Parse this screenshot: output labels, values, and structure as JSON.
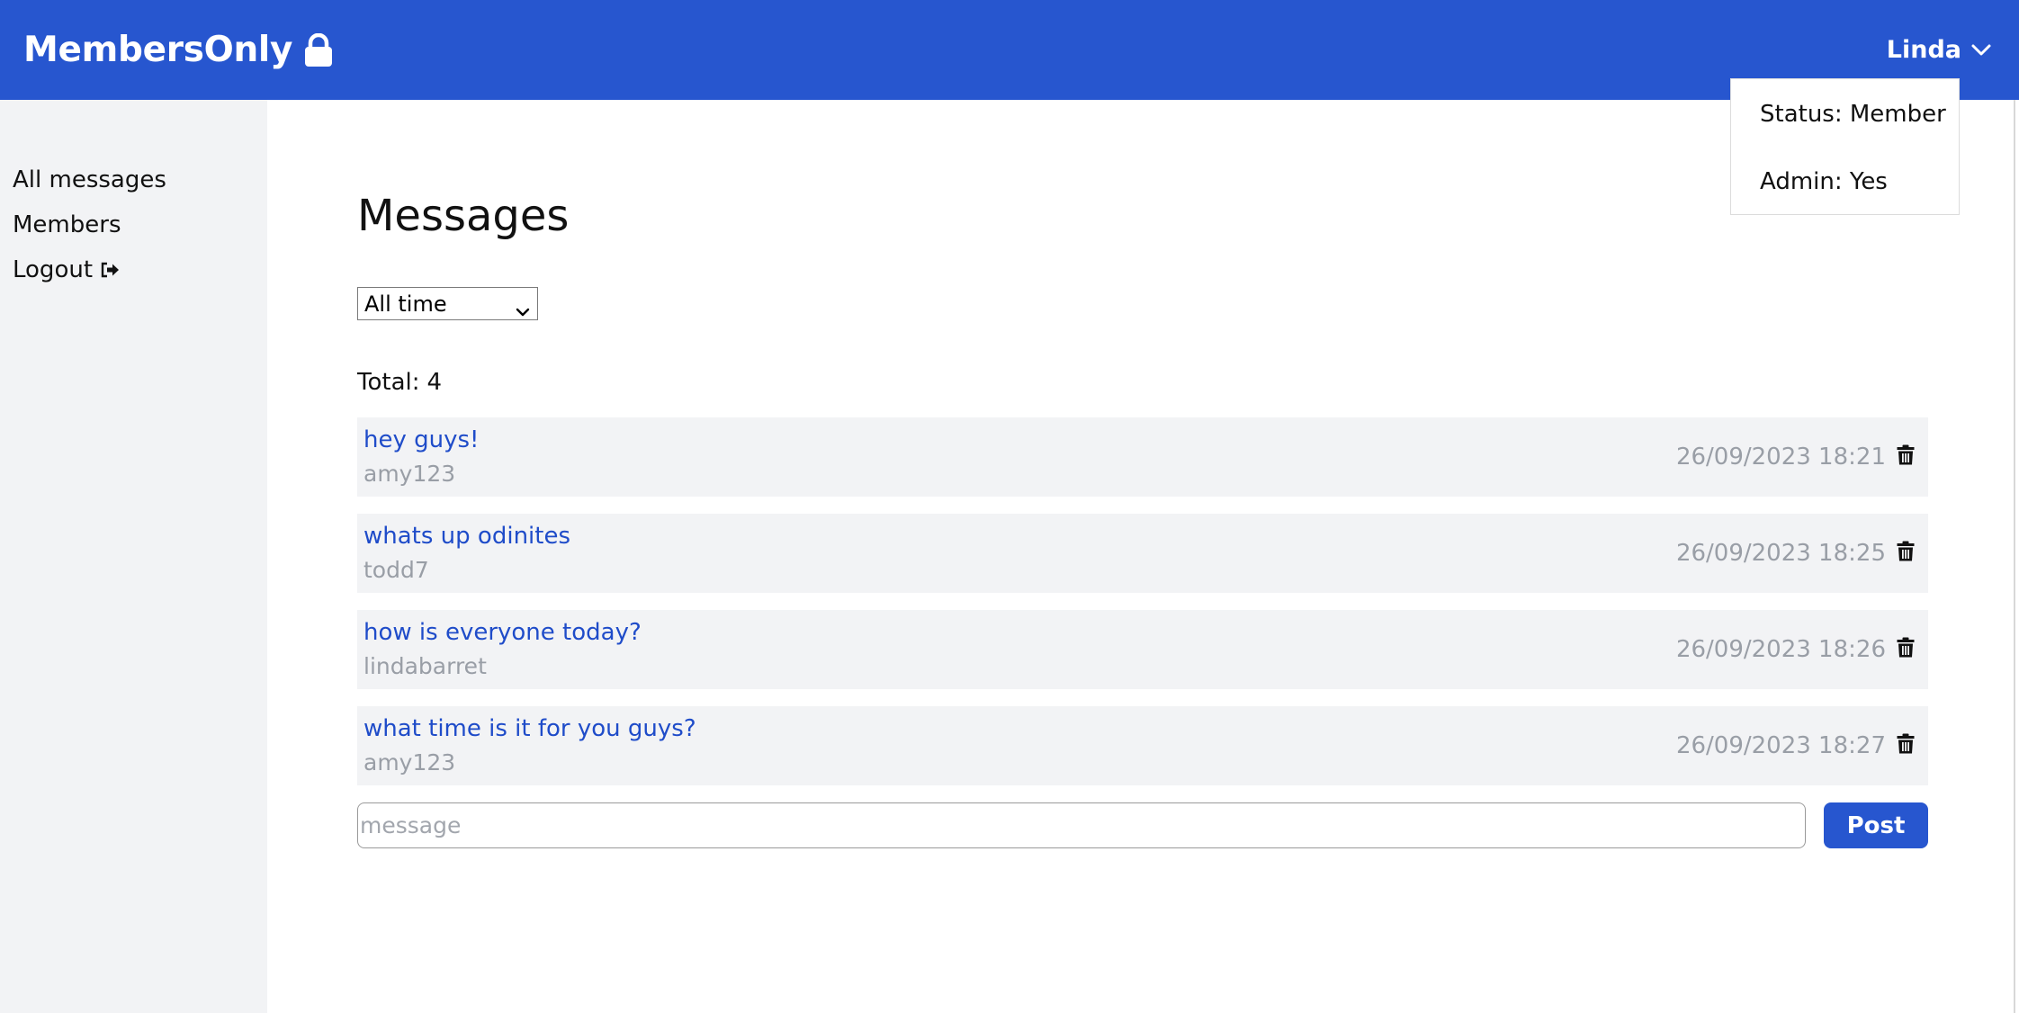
{
  "header": {
    "brand": "MembersOnly",
    "brand_icon": "lock-icon",
    "user_name": "Linda",
    "user_menu_icon": "chevron-down-icon",
    "background": "#2756cf"
  },
  "user_dropdown": {
    "status": "Status: Member",
    "admin": "Admin: Yes"
  },
  "sidebar": {
    "items": [
      {
        "label": "All messages"
      },
      {
        "label": "Members"
      },
      {
        "label": "Logout",
        "icon": "logout-icon"
      }
    ]
  },
  "main": {
    "title": "Messages",
    "filter": {
      "selected": "All time"
    },
    "total_label": "Total:",
    "total_count": "4",
    "messages": [
      {
        "text": "hey guys!",
        "author": "amy123",
        "timestamp": "26/09/2023 18:21"
      },
      {
        "text": "whats up odinites",
        "author": "todd7",
        "timestamp": "26/09/2023 18:25"
      },
      {
        "text": "how is everyone today?",
        "author": "lindabarret",
        "timestamp": "26/09/2023 18:26"
      },
      {
        "text": "what time is it for you guys?",
        "author": "amy123",
        "timestamp": "26/09/2023 18:27"
      }
    ],
    "compose": {
      "placeholder": "message",
      "post_label": "Post"
    }
  },
  "colors": {
    "accent": "#2756cf",
    "link": "#1f4cc9",
    "muted_text": "#999ea6",
    "panel_bg": "#f2f3f5"
  }
}
